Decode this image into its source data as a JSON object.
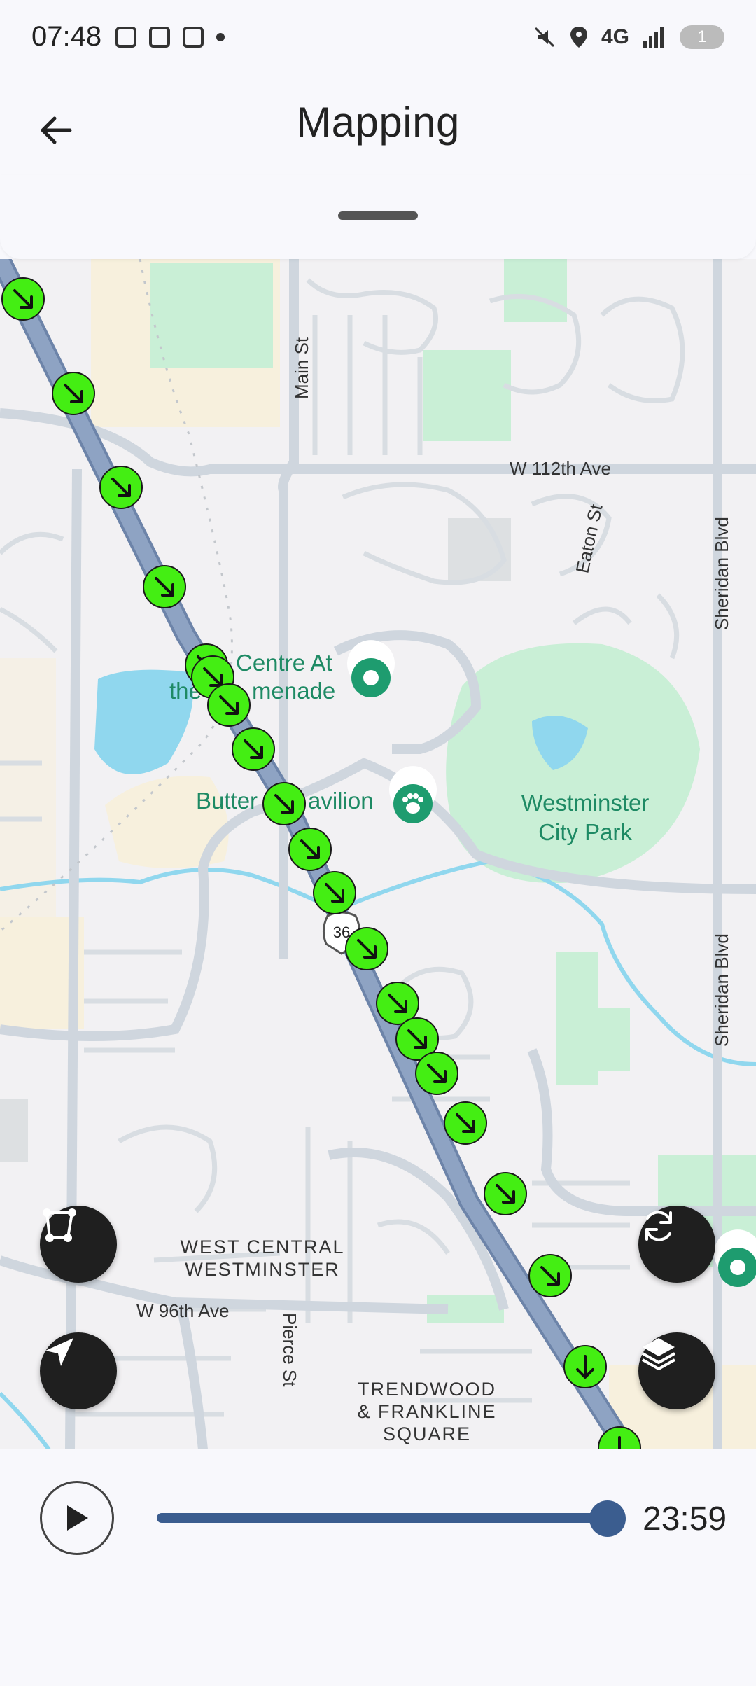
{
  "status_bar": {
    "time": "07:48",
    "network": "4G",
    "battery": "1",
    "left_icons": [
      "notification-icon",
      "screenshot-icon",
      "calendar-icon"
    ],
    "right_icons": [
      "mute-icon",
      "location-icon",
      "signal-icon",
      "battery-icon"
    ]
  },
  "app_bar": {
    "title": "Mapping",
    "back_icon": "arrow-left-icon"
  },
  "map": {
    "labels": {
      "main_st": "Main St",
      "w112": "W 112th Ave",
      "eaton": "Eaton St",
      "sheridan_top": "Sheridan Blvd",
      "sheridan_bottom": "Sheridan Blvd",
      "centre_line1": "Centre At",
      "centre_line2_a": "the",
      "centre_line2_b": "menade",
      "butterfly_a": "Butter",
      "butterfly_b": "avilion",
      "park_line1": "Westminster",
      "park_line2": "City Park",
      "west_central_1": "WEST CENTRAL",
      "west_central_2": "WESTMINSTER",
      "w96": "W 96th Ave",
      "pierce": "Pierce St",
      "trendwood_1": "TRENDWOOD",
      "trendwood_2": "& FRANKLINE",
      "trendwood_3": "SQUARE",
      "route_shield": "36"
    },
    "colors": {
      "marker_fill": "#44ee13",
      "route": "#8ea3c3",
      "poi": "#1e9c6f",
      "water": "#90d7ee",
      "park": "#c9efd6"
    },
    "fab_icons": {
      "polygon": "polygon-select-icon",
      "locate": "navigation-arrow-icon",
      "refresh": "refresh-icon",
      "layers": "layers-icon"
    }
  },
  "player": {
    "play_icon": "play-icon",
    "time": "23:59",
    "progress": 1.0
  }
}
